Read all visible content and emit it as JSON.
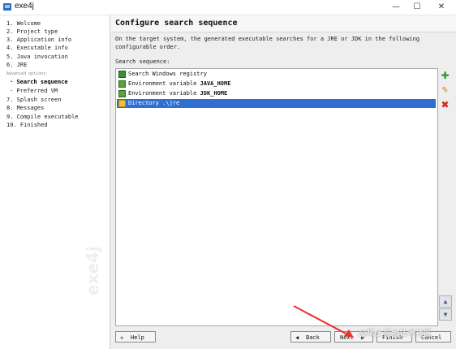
{
  "window": {
    "title": "exe4j",
    "minimize": "—",
    "maximize": "☐",
    "close": "✕"
  },
  "sidebar": {
    "steps": [
      {
        "label": "1. Welcome"
      },
      {
        "label": "2. Project type"
      },
      {
        "label": "3. Application info"
      },
      {
        "label": "4. Executable info"
      },
      {
        "label": "5. Java invocation"
      },
      {
        "label": "6. JRE"
      },
      {
        "label": "Advanced options:"
      },
      {
        "label": "· Search sequence"
      },
      {
        "label": "· Preferred VM"
      },
      {
        "label": "7. Splash screen"
      },
      {
        "label": "8. Messages"
      },
      {
        "label": "9. Compile executable"
      },
      {
        "label": "10. Finished"
      }
    ],
    "watermark": "exe4j"
  },
  "header": {
    "title": "Configure search sequence"
  },
  "description": "On the target system, the generated executable searches for a JRE or JDK in the following configurable order.",
  "sequence": {
    "label": "Search sequence:",
    "items": [
      {
        "text": "Search Windows registry",
        "bold": "",
        "icon": "registry-icon"
      },
      {
        "text": "Environment variable ",
        "bold": "JAVA_HOME",
        "icon": "env-variable-icon"
      },
      {
        "text": "Environment variable ",
        "bold": "JDK_HOME",
        "icon": "env-variable-icon"
      },
      {
        "text": "Directory .\\jre",
        "bold": "",
        "icon": "folder-icon",
        "selected": true
      }
    ]
  },
  "side_buttons": {
    "add": "✚",
    "edit": "✎",
    "remove": "✖",
    "up": "▲",
    "down": "▼"
  },
  "footer": {
    "help": "Help",
    "back": "Back",
    "next": "Next",
    "finish": "Finish",
    "cancel": "Cancel"
  },
  "overlay": {
    "watermark_text": "@稀土掘金技术社区"
  },
  "colors": {
    "selection": "#2f6fd2",
    "annotation_arrow": "#e8312a"
  }
}
